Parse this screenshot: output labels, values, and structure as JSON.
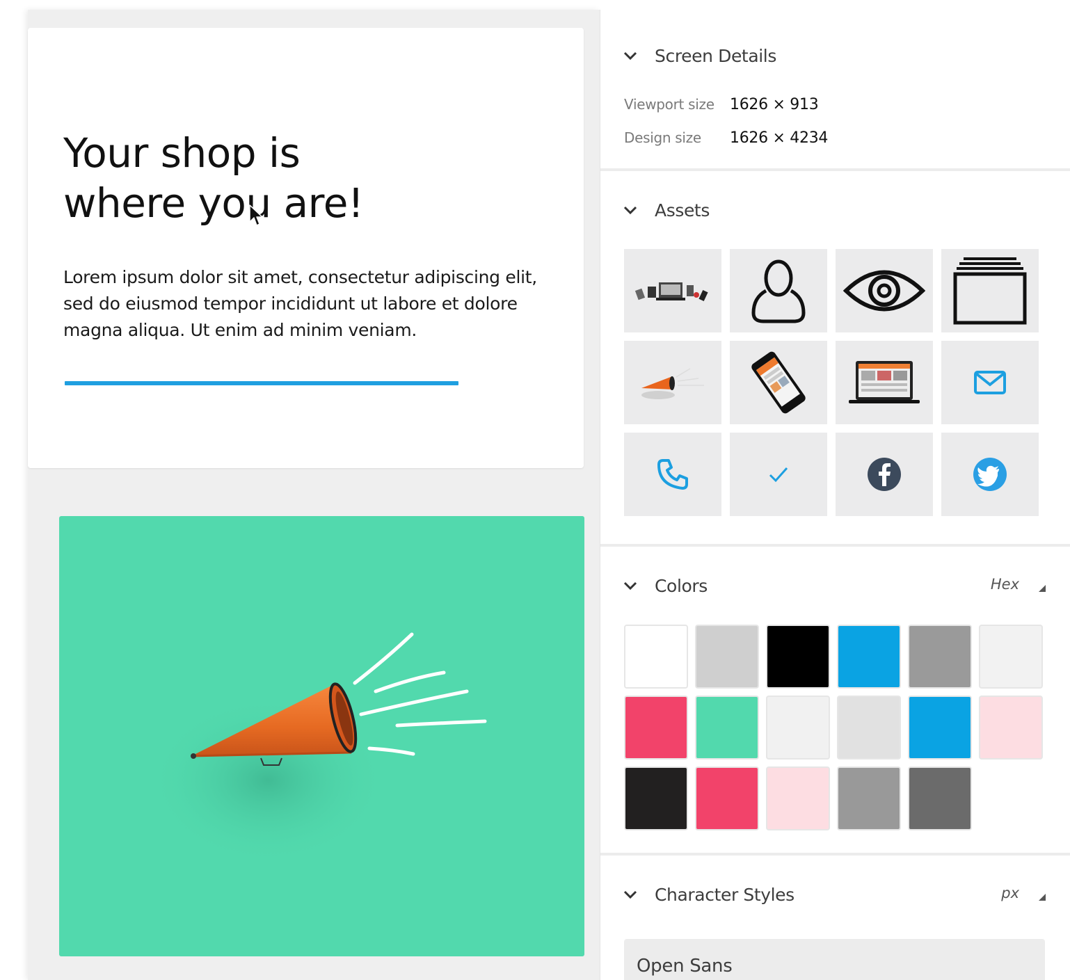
{
  "preview": {
    "hero": {
      "title_line1": "Your shop is",
      "title_line2": "where you are!",
      "body": "Lorem ipsum dolor sit amet, consectetur adipiscing elit, sed do eiusmod tempor incididunt ut labore et dolore magna aliqua. Ut enim ad minim veniam.",
      "underline_color": "#1f9fe0"
    },
    "promo": {
      "background": "#52d9ad",
      "illustration": "megaphone-illustration"
    }
  },
  "panel": {
    "screen_details": {
      "title": "Screen Details",
      "rows": [
        {
          "label": "Viewport size",
          "value": "1626 × 913"
        },
        {
          "label": "Design size",
          "value": "1626 × 4234"
        }
      ]
    },
    "assets": {
      "title": "Assets",
      "items": [
        "devices-photo",
        "user-icon",
        "eye-icon",
        "stack-icon",
        "megaphone-photo",
        "phone-photo",
        "laptop-photo",
        "mail-icon",
        "phone-call-icon",
        "check-icon",
        "facebook-icon",
        "twitter-icon"
      ]
    },
    "colors": {
      "title": "Colors",
      "format": "Hex",
      "swatches": [
        "#ffffff",
        "#cfcfcf",
        "#000000",
        "#0aa3e3",
        "#9a9a9a",
        "#f2f2f2",
        "#f2436a",
        "#52d9ad",
        "#f1f1f1",
        "#e1e1e1",
        "#0aa3e3",
        "#fddde2",
        "#222020",
        "#f2436a",
        "#fddde2",
        "#999999",
        "#6b6b6b"
      ]
    },
    "character_styles": {
      "title": "Character Styles",
      "unit": "px",
      "fonts": [
        {
          "name": "Open Sans"
        }
      ]
    }
  }
}
